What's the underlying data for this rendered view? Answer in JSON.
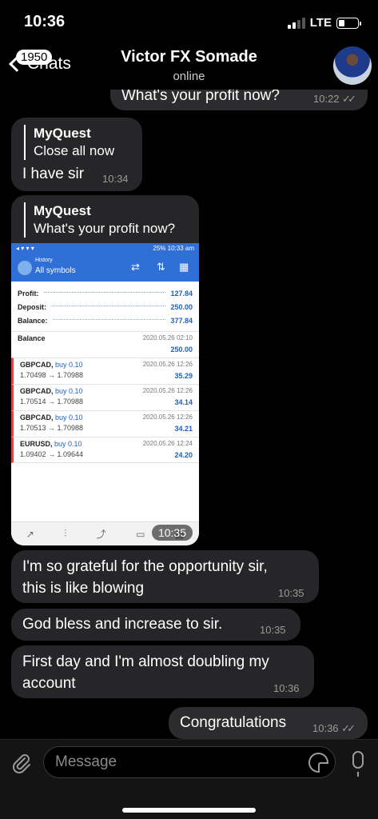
{
  "status_bar": {
    "time": "10:36",
    "network": "LTE"
  },
  "header": {
    "back_label": "Chats",
    "unread_badge": "1950",
    "title": "Victor FX Somade",
    "subtitle": "online"
  },
  "messages": [
    {
      "direction": "out",
      "text": "What's your profit now?",
      "time": "10:22"
    },
    {
      "direction": "in",
      "reply_to": {
        "name": "MyQuest",
        "text": "Close all now"
      },
      "text": "I have sir",
      "time": "10:34"
    },
    {
      "direction": "in",
      "reply_to": {
        "name": "MyQuest",
        "text": "What's your profit now?"
      },
      "time": "10:35"
    },
    {
      "direction": "in",
      "text_line1": "I'm so grateful for the opportunity sir,",
      "text_line2": "this is like blowing",
      "time": "10:35"
    },
    {
      "direction": "in",
      "text": "God bless and increase to sir.",
      "time": "10:35"
    },
    {
      "direction": "in",
      "text_line1": "First day and I'm almost doubling my",
      "text_line2": "account",
      "time": "10:36"
    },
    {
      "direction": "out",
      "text": "Congratulations",
      "time": "10:36"
    }
  ],
  "screenshot": {
    "status_right": "25%  10:33 am",
    "app_small": "History",
    "app_title": "All symbols",
    "summary": [
      {
        "label": "Profit:",
        "value": "127.84"
      },
      {
        "label": "Deposit:",
        "value": "250.00"
      },
      {
        "label": "Balance:",
        "value": "377.84"
      }
    ],
    "balance_row": {
      "label": "Balance",
      "date": "2020.05.26 02:10",
      "value": "250.00"
    },
    "deals": [
      {
        "symbol": "GBPCAD,",
        "side": "buy 0.10",
        "prices": "1.70498 → 1.70988",
        "date": "2020.05.26 12:26",
        "profit": "35.29"
      },
      {
        "symbol": "GBPCAD,",
        "side": "buy 0.10",
        "prices": "1.70514 → 1.70988",
        "date": "2020.05.26 12:26",
        "profit": "34.14"
      },
      {
        "symbol": "GBPCAD,",
        "side": "buy 0.10",
        "prices": "1.70513 → 1.70988",
        "date": "2020.05.26 12:26",
        "profit": "34.21"
      },
      {
        "symbol": "EURUSD,",
        "side": "buy 0.10",
        "prices": "1.09402 → 1.09644",
        "date": "2020.05.26 12:24",
        "profit": "24.20"
      }
    ]
  },
  "composer": {
    "placeholder": "Message"
  },
  "icons": [
    "paperclip-icon",
    "sticker-icon",
    "microphone-icon",
    "back-chevron-icon",
    "read-receipt-icon"
  ]
}
